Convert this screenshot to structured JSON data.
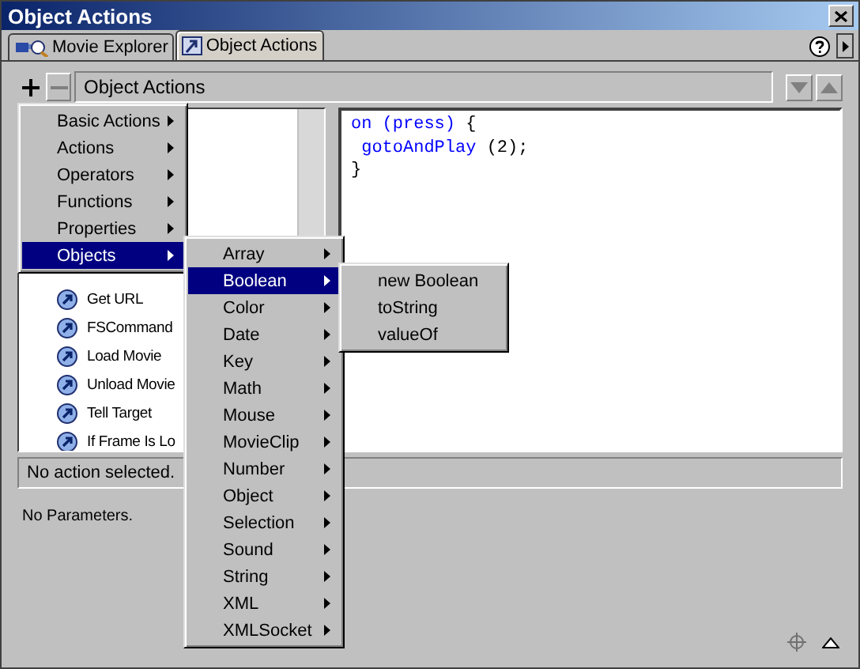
{
  "window": {
    "title": "Object Actions"
  },
  "tabs": [
    {
      "label": "Movie Explorer",
      "selected": false
    },
    {
      "label": "Object Actions",
      "selected": true
    }
  ],
  "toolbar": {
    "add_disabled": false,
    "remove_disabled": true,
    "field": "Object Actions",
    "down_disabled": true,
    "up_disabled": true
  },
  "action_list": [
    {
      "label": "Get URL"
    },
    {
      "label": "FSCommand"
    },
    {
      "label": "Load Movie"
    },
    {
      "label": "Unload Movie"
    },
    {
      "label": "Tell Target"
    },
    {
      "label": "If Frame Is Lo"
    }
  ],
  "code": [
    [
      {
        "kind": "keyword",
        "text": "on (press)"
      },
      {
        "kind": "plain",
        "text": " {"
      }
    ],
    [
      {
        "kind": "keyword",
        "text": " gotoAndPlay"
      },
      {
        "kind": "plain",
        "text": " (2);"
      }
    ],
    [
      {
        "kind": "plain",
        "text": "}"
      }
    ]
  ],
  "status": "No action selected.",
  "parameters": "No Parameters.",
  "menus": [
    {
      "items": [
        {
          "label": "Basic Actions",
          "submenu": true,
          "selected": false
        },
        {
          "label": "Actions",
          "submenu": true,
          "selected": false
        },
        {
          "label": "Operators",
          "submenu": true,
          "selected": false
        },
        {
          "label": "Functions",
          "submenu": true,
          "selected": false
        },
        {
          "label": "Properties",
          "submenu": true,
          "selected": false
        },
        {
          "label": "Objects",
          "submenu": true,
          "selected": true
        }
      ]
    },
    {
      "items": [
        {
          "label": "Array",
          "submenu": true,
          "selected": false
        },
        {
          "label": "Boolean",
          "submenu": true,
          "selected": true
        },
        {
          "label": "Color",
          "submenu": true,
          "selected": false
        },
        {
          "label": "Date",
          "submenu": true,
          "selected": false
        },
        {
          "label": "Key",
          "submenu": true,
          "selected": false
        },
        {
          "label": "Math",
          "submenu": true,
          "selected": false
        },
        {
          "label": "Mouse",
          "submenu": true,
          "selected": false
        },
        {
          "label": "MovieClip",
          "submenu": true,
          "selected": false
        },
        {
          "label": "Number",
          "submenu": true,
          "selected": false
        },
        {
          "label": "Object",
          "submenu": true,
          "selected": false
        },
        {
          "label": "Selection",
          "submenu": true,
          "selected": false
        },
        {
          "label": "Sound",
          "submenu": true,
          "selected": false
        },
        {
          "label": "String",
          "submenu": true,
          "selected": false
        },
        {
          "label": "XML",
          "submenu": true,
          "selected": false
        },
        {
          "label": "XMLSocket",
          "submenu": true,
          "selected": false
        }
      ]
    },
    {
      "items": [
        {
          "label": "new Boolean",
          "submenu": false,
          "selected": false
        },
        {
          "label": "toString",
          "submenu": false,
          "selected": false
        },
        {
          "label": "valueOf",
          "submenu": false,
          "selected": false
        }
      ]
    }
  ]
}
